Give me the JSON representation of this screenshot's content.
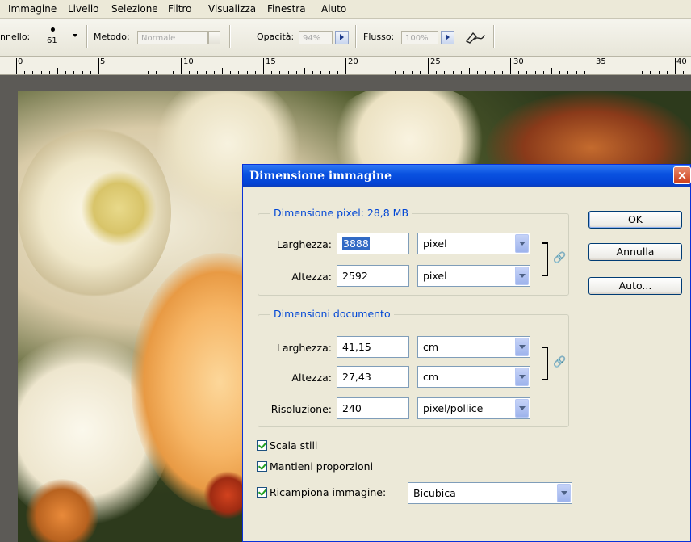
{
  "menubar": {
    "items": [
      "Immagine",
      "Livello",
      "Selezione",
      "Filtro",
      "Visualizza",
      "Finestra",
      "Aiuto"
    ]
  },
  "options": {
    "brush_label": "nnello:",
    "brush_size": "61",
    "method_label": "Metodo:",
    "method_value": "Normale",
    "opacity_label": "Opacità:",
    "opacity_value": "94%",
    "flow_label": "Flusso:",
    "flow_value": "100%"
  },
  "ruler": {
    "labels": [
      "0",
      "5",
      "10",
      "15",
      "20",
      "25",
      "30",
      "35",
      "40"
    ]
  },
  "dialog": {
    "title": "Dimensione immagine",
    "close_glyph": "×",
    "pixel_group": {
      "label": "Dimensione pixel: 28,8 MB",
      "width_label": "Larghezza:",
      "width_value": "3888",
      "width_unit": "pixel",
      "height_label": "Altezza:",
      "height_value": "2592",
      "height_unit": "pixel"
    },
    "doc_group": {
      "label": "Dimensioni documento",
      "width_label": "Larghezza:",
      "width_value": "41,15",
      "width_unit": "cm",
      "height_label": "Altezza:",
      "height_value": "27,43",
      "height_unit": "cm",
      "resolution_label": "Risoluzione:",
      "resolution_value": "240",
      "resolution_unit": "pixel/pollice"
    },
    "checkboxes": {
      "scale_styles": "Scala stili",
      "constrain": "Mantieni proporzioni",
      "resample": "Ricampiona immagine:"
    },
    "resample_method": "Bicubica",
    "buttons": {
      "ok": "OK",
      "cancel": "Annulla",
      "auto": "Auto..."
    }
  },
  "colors": {
    "title_blue": "#0a52e0",
    "group_label_blue": "#0046d5",
    "dialog_bg": "#ece9d8",
    "close_red": "#cc3d1a"
  }
}
